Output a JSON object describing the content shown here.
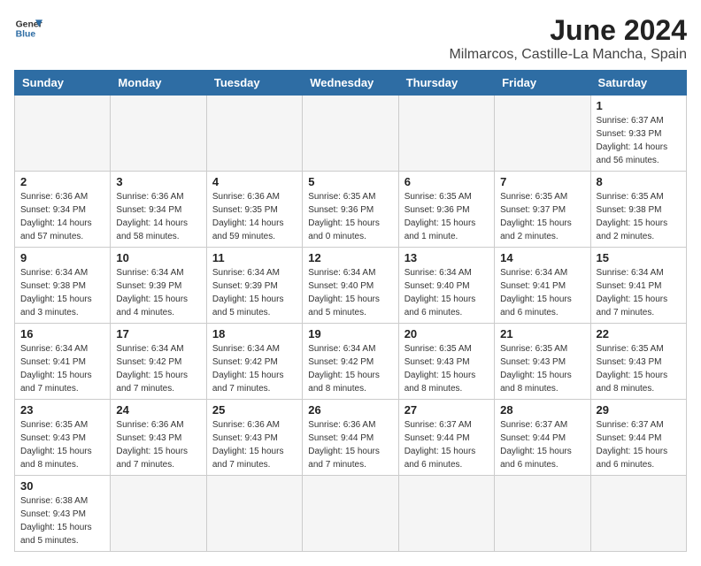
{
  "header": {
    "logo_line1": "General",
    "logo_line2": "Blue",
    "title": "June 2024",
    "subtitle": "Milmarcos, Castille-La Mancha, Spain"
  },
  "weekdays": [
    "Sunday",
    "Monday",
    "Tuesday",
    "Wednesday",
    "Thursday",
    "Friday",
    "Saturday"
  ],
  "weeks": [
    [
      {
        "day": "",
        "info": ""
      },
      {
        "day": "",
        "info": ""
      },
      {
        "day": "",
        "info": ""
      },
      {
        "day": "",
        "info": ""
      },
      {
        "day": "",
        "info": ""
      },
      {
        "day": "",
        "info": ""
      },
      {
        "day": "1",
        "info": "Sunrise: 6:37 AM\nSunset: 9:33 PM\nDaylight: 14 hours\nand 56 minutes."
      }
    ],
    [
      {
        "day": "2",
        "info": "Sunrise: 6:36 AM\nSunset: 9:34 PM\nDaylight: 14 hours\nand 57 minutes."
      },
      {
        "day": "3",
        "info": "Sunrise: 6:36 AM\nSunset: 9:34 PM\nDaylight: 14 hours\nand 58 minutes."
      },
      {
        "day": "4",
        "info": "Sunrise: 6:36 AM\nSunset: 9:35 PM\nDaylight: 14 hours\nand 59 minutes."
      },
      {
        "day": "5",
        "info": "Sunrise: 6:35 AM\nSunset: 9:36 PM\nDaylight: 15 hours\nand 0 minutes."
      },
      {
        "day": "6",
        "info": "Sunrise: 6:35 AM\nSunset: 9:36 PM\nDaylight: 15 hours\nand 1 minute."
      },
      {
        "day": "7",
        "info": "Sunrise: 6:35 AM\nSunset: 9:37 PM\nDaylight: 15 hours\nand 2 minutes."
      },
      {
        "day": "8",
        "info": "Sunrise: 6:35 AM\nSunset: 9:38 PM\nDaylight: 15 hours\nand 2 minutes."
      }
    ],
    [
      {
        "day": "9",
        "info": "Sunrise: 6:34 AM\nSunset: 9:38 PM\nDaylight: 15 hours\nand 3 minutes."
      },
      {
        "day": "10",
        "info": "Sunrise: 6:34 AM\nSunset: 9:39 PM\nDaylight: 15 hours\nand 4 minutes."
      },
      {
        "day": "11",
        "info": "Sunrise: 6:34 AM\nSunset: 9:39 PM\nDaylight: 15 hours\nand 5 minutes."
      },
      {
        "day": "12",
        "info": "Sunrise: 6:34 AM\nSunset: 9:40 PM\nDaylight: 15 hours\nand 5 minutes."
      },
      {
        "day": "13",
        "info": "Sunrise: 6:34 AM\nSunset: 9:40 PM\nDaylight: 15 hours\nand 6 minutes."
      },
      {
        "day": "14",
        "info": "Sunrise: 6:34 AM\nSunset: 9:41 PM\nDaylight: 15 hours\nand 6 minutes."
      },
      {
        "day": "15",
        "info": "Sunrise: 6:34 AM\nSunset: 9:41 PM\nDaylight: 15 hours\nand 7 minutes."
      }
    ],
    [
      {
        "day": "16",
        "info": "Sunrise: 6:34 AM\nSunset: 9:41 PM\nDaylight: 15 hours\nand 7 minutes."
      },
      {
        "day": "17",
        "info": "Sunrise: 6:34 AM\nSunset: 9:42 PM\nDaylight: 15 hours\nand 7 minutes."
      },
      {
        "day": "18",
        "info": "Sunrise: 6:34 AM\nSunset: 9:42 PM\nDaylight: 15 hours\nand 7 minutes."
      },
      {
        "day": "19",
        "info": "Sunrise: 6:34 AM\nSunset: 9:42 PM\nDaylight: 15 hours\nand 8 minutes."
      },
      {
        "day": "20",
        "info": "Sunrise: 6:35 AM\nSunset: 9:43 PM\nDaylight: 15 hours\nand 8 minutes."
      },
      {
        "day": "21",
        "info": "Sunrise: 6:35 AM\nSunset: 9:43 PM\nDaylight: 15 hours\nand 8 minutes."
      },
      {
        "day": "22",
        "info": "Sunrise: 6:35 AM\nSunset: 9:43 PM\nDaylight: 15 hours\nand 8 minutes."
      }
    ],
    [
      {
        "day": "23",
        "info": "Sunrise: 6:35 AM\nSunset: 9:43 PM\nDaylight: 15 hours\nand 8 minutes."
      },
      {
        "day": "24",
        "info": "Sunrise: 6:36 AM\nSunset: 9:43 PM\nDaylight: 15 hours\nand 7 minutes."
      },
      {
        "day": "25",
        "info": "Sunrise: 6:36 AM\nSunset: 9:43 PM\nDaylight: 15 hours\nand 7 minutes."
      },
      {
        "day": "26",
        "info": "Sunrise: 6:36 AM\nSunset: 9:44 PM\nDaylight: 15 hours\nand 7 minutes."
      },
      {
        "day": "27",
        "info": "Sunrise: 6:37 AM\nSunset: 9:44 PM\nDaylight: 15 hours\nand 6 minutes."
      },
      {
        "day": "28",
        "info": "Sunrise: 6:37 AM\nSunset: 9:44 PM\nDaylight: 15 hours\nand 6 minutes."
      },
      {
        "day": "29",
        "info": "Sunrise: 6:37 AM\nSunset: 9:44 PM\nDaylight: 15 hours\nand 6 minutes."
      }
    ],
    [
      {
        "day": "30",
        "info": "Sunrise: 6:38 AM\nSunset: 9:43 PM\nDaylight: 15 hours\nand 5 minutes."
      },
      {
        "day": "",
        "info": ""
      },
      {
        "day": "",
        "info": ""
      },
      {
        "day": "",
        "info": ""
      },
      {
        "day": "",
        "info": ""
      },
      {
        "day": "",
        "info": ""
      },
      {
        "day": "",
        "info": ""
      }
    ]
  ]
}
